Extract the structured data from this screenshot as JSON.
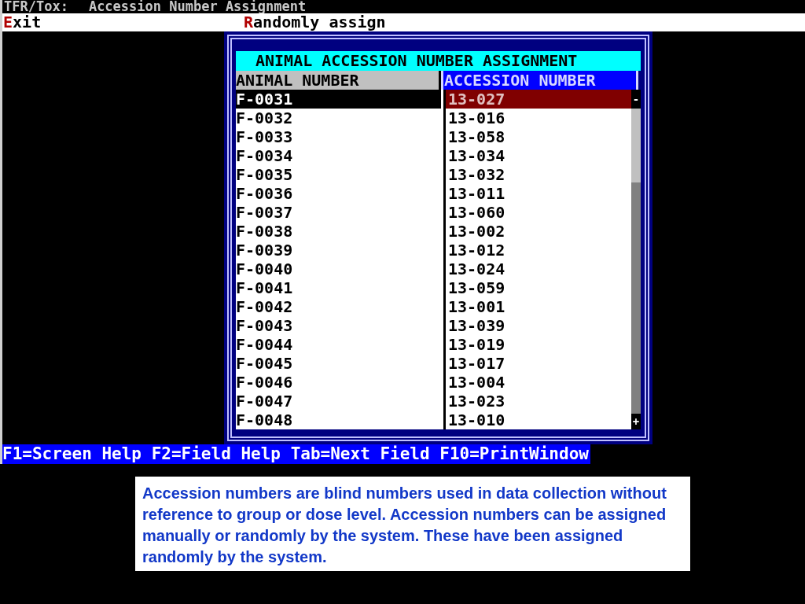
{
  "title_bar": {
    "app": "TFR/Tox:",
    "title": "Accession Number Assignment"
  },
  "menu": [
    {
      "hotkey": "E",
      "rest": "xit"
    },
    {
      "hotkey": "R",
      "rest": "andomly assign"
    }
  ],
  "dialog": {
    "title": "ANIMAL ACCESSION NUMBER ASSIGNMENT",
    "columns": [
      "ANIMAL NUMBER",
      "ACCESSION NUMBER"
    ],
    "rows": [
      {
        "animal": "F-0031",
        "accession": "13-027",
        "selected": true
      },
      {
        "animal": "F-0032",
        "accession": "13-016",
        "selected": false
      },
      {
        "animal": "F-0033",
        "accession": "13-058",
        "selected": false
      },
      {
        "animal": "F-0034",
        "accession": "13-034",
        "selected": false
      },
      {
        "animal": "F-0035",
        "accession": "13-032",
        "selected": false
      },
      {
        "animal": "F-0036",
        "accession": "13-011",
        "selected": false
      },
      {
        "animal": "F-0037",
        "accession": "13-060",
        "selected": false
      },
      {
        "animal": "F-0038",
        "accession": "13-002",
        "selected": false
      },
      {
        "animal": "F-0039",
        "accession": "13-012",
        "selected": false
      },
      {
        "animal": "F-0040",
        "accession": "13-024",
        "selected": false
      },
      {
        "animal": "F-0041",
        "accession": "13-059",
        "selected": false
      },
      {
        "animal": "F-0042",
        "accession": "13-001",
        "selected": false
      },
      {
        "animal": "F-0043",
        "accession": "13-039",
        "selected": false
      },
      {
        "animal": "F-0044",
        "accession": "13-019",
        "selected": false
      },
      {
        "animal": "F-0045",
        "accession": "13-017",
        "selected": false
      },
      {
        "animal": "F-0046",
        "accession": "13-004",
        "selected": false
      },
      {
        "animal": "F-0047",
        "accession": "13-023",
        "selected": false
      },
      {
        "animal": "F-0048",
        "accession": "13-010",
        "selected": false
      }
    ],
    "scrollbar": {
      "up": "-",
      "down": "+"
    }
  },
  "status_bar": "F1=Screen Help F2=Field Help Tab=Next Field F10=PrintWindow",
  "caption": "Accession numbers are blind numbers used in data collection without reference to group or dose level. Accession numbers can be assigned manually or randomly by the system. These have been assigned randomly by the system."
}
